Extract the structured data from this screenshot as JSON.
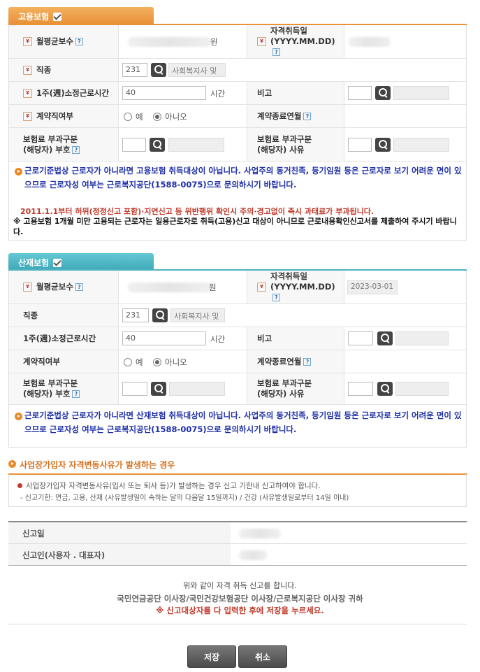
{
  "employment": {
    "tab_label": "고용보험",
    "avg_wage_label": "월평균보수",
    "wage_unit": "원",
    "acq_date_label": "자격취득일",
    "acq_date_format": "(YYYY.MM.DD)",
    "job_label": "직종",
    "job_code": "231",
    "job_name": "사회복지사 및",
    "hours_label": "1주(週)소정근로시간",
    "hours_value": "40",
    "hours_unit": "시간",
    "remark_label": "비고",
    "contract_label": "계약직여부",
    "radio_yes": "예",
    "radio_no": "아니오",
    "contract_end_label": "계약종료연월",
    "levy_code_label_1": "보험료 부과구분",
    "levy_code_label_2": "(해당자) 부호",
    "levy_reason_label_1": "보험료 부과구분",
    "levy_reason_label_2": "(해당자) 사유",
    "notice_blue": "근로기준법상 근로자가 아니라면 고용보험 취득대상이 아닙니다. 사업주의 동거친족, 등기임원 등은 근로자로 보기 어려운 면이 있으므로 근로자성 여부는 근로복지공단(1588-0075)으로 문의하시기 바랍니다.",
    "notice_red": "2011.1.1부터 허위(정정신고 포함)·지연신고 등 위반행위 확인시 주의·경고없이 즉시 과태료가 부과됩니다.",
    "notice_black": "※ 고용보험 1개월 미만 고용되는 근로자는 일용근로자로 취득(고용)신고 대상이 아니므로 근로내용확인신고서를 제출하여 주시기 바랍니다."
  },
  "industrial": {
    "tab_label": "산재보험",
    "avg_wage_label": "월평균보수",
    "wage_unit": "원",
    "acq_date_label": "자격취득일",
    "acq_date_format": "(YYYY.MM.DD)",
    "acq_date_value": "2023-03-01",
    "job_label": "직종",
    "job_code": "231",
    "job_name": "사회복지사 및",
    "hours_label": "1주(週)소정근로시간",
    "hours_value": "40",
    "hours_unit": "시간",
    "remark_label": "비고",
    "contract_label": "계약직여부",
    "radio_yes": "예",
    "radio_no": "아니오",
    "contract_end_label": "계약종료연월",
    "levy_code_label_1": "보험료 부과구분",
    "levy_code_label_2": "(해당자) 부호",
    "levy_reason_label_1": "보험료 부과구분",
    "levy_reason_label_2": "(해당자) 사유",
    "notice_blue": "근로기준법상 근로자가 아니라면 산재보험 취득대상이 아닙니다. 사업주의 동거친족, 등기임원 등은 근로자로 보기 어려운 면이 있으므로 근로자성 여부는 근로복지공단(1588-0075)으로 문의하시기 바랍니다."
  },
  "change": {
    "title": "사업장가입자 자격변동사유가 발생하는 경우",
    "line1": "사업장가입자 자격변동사유(입사 또는 퇴사 등)가 발생하는 경우 신고 기한내 신고하여야 합니다.",
    "line2": "- 신고기한: 연금, 고용, 산재 (사유발생일이 속하는 달의 다음달 15일까지) / 건강 (사유발생일로부터 14일 이내)"
  },
  "report": {
    "date_label": "신고일",
    "reporter_label": "신고인(사용자 . 대표자)"
  },
  "footer": {
    "line1": "위와 같이 자격 취득 신고를 합니다.",
    "line2": "국민연금공단 이사장/국민건강보험공단 이사장/근로복지공단 이사장 귀하",
    "line3": "※ 신고대상자를 다 입력한 후에 저장을 누르세요."
  },
  "buttons": {
    "save": "저장",
    "cancel": "취소"
  }
}
